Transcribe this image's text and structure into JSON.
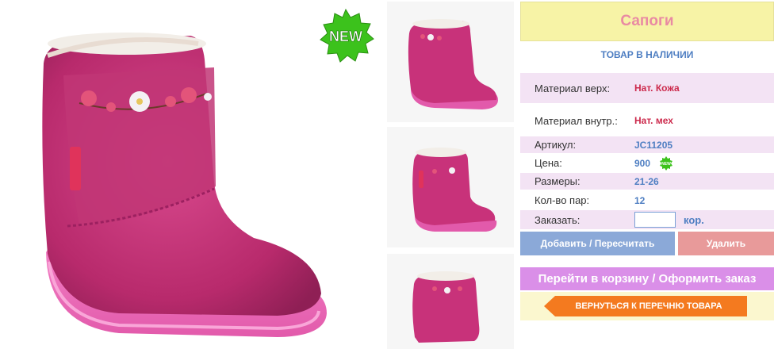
{
  "product": {
    "title": "Сапоги",
    "stock_status": "ТОВАР В НАЛИЧИИ",
    "badge_text": "NEW",
    "mini_badge_text": "NEW"
  },
  "specs": [
    {
      "label": "Материал верх:",
      "value": "Нат. Кожа"
    },
    {
      "label": "Материал внутр.:",
      "value": "Нат. мех"
    },
    {
      "label": "Артикул:",
      "value": "JC11205"
    },
    {
      "label": "Цена:",
      "value": "900"
    },
    {
      "label": "Размеры:",
      "value": "21-26"
    },
    {
      "label": "Кол-во пар:",
      "value": "12"
    }
  ],
  "order": {
    "label": "Заказать:",
    "quantity_value": "",
    "unit": "кор."
  },
  "buttons": {
    "add": "Добавить / Пересчитать",
    "delete": "Удалить",
    "cart": "Перейти в корзину / Оформить заказ",
    "back": "ВЕРНУТЬСЯ К ПЕРЕЧНЮ ТОВАРА"
  },
  "colors": {
    "boot": "#c8327a",
    "title_bg": "#f7f3a6",
    "title_text": "#e98aa3",
    "accent_blue": "#4e7ec2",
    "value_red": "#cc2a4c",
    "add_button": "#8ba9d8",
    "delete_button": "#e89a9a",
    "cart_button": "#da8fe8",
    "back_button": "#f47a1f",
    "badge_green": "#3cc21c"
  }
}
